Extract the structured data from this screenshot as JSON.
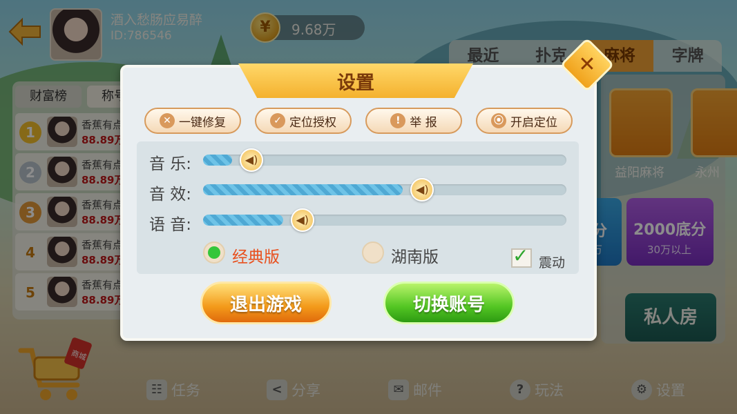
{
  "profile": {
    "nickname": "酒入愁肠应易醉",
    "id_text": "ID:786546",
    "coins": "9.68万"
  },
  "game_tabs": [
    "最近",
    "扑克",
    "麻将",
    "字牌"
  ],
  "active_game_tab": 2,
  "game_cards": [
    {
      "label": "益阳麻将"
    },
    {
      "label": "永州"
    }
  ],
  "level_cards": [
    {
      "title": "分",
      "sub": "万"
    },
    {
      "title": "2000底分",
      "sub": "30万以上"
    }
  ],
  "private_room_label": "私人房",
  "rank": {
    "tabs": [
      "财富榜",
      "称号榜"
    ],
    "rows": [
      {
        "badge": "1",
        "name": "香蕉有点",
        "score": "88.89万"
      },
      {
        "badge": "2",
        "name": "香蕉有点",
        "score": "88.89万"
      },
      {
        "badge": "3",
        "name": "香蕉有点",
        "score": "88.89万"
      },
      {
        "badge": "4",
        "name": "香蕉有点",
        "score": "88.89万"
      },
      {
        "badge": "5",
        "name": "香蕉有点",
        "score": "88.89万"
      }
    ]
  },
  "bottom_nav": [
    "任务",
    "分享",
    "邮件",
    "玩法",
    "设置"
  ],
  "shop_label": "商城",
  "settings": {
    "title": "设置",
    "actions": [
      "一键修复",
      "定位授权",
      "举 报",
      "开启定位"
    ],
    "sliders": [
      {
        "label": "音 乐:",
        "value": 0.08
      },
      {
        "label": "音 效:",
        "value": 0.55
      },
      {
        "label": "语 音:",
        "value": 0.22
      }
    ],
    "versions": [
      {
        "label": "经典版",
        "checked": true,
        "color": "#e8501e"
      },
      {
        "label": "湖南版",
        "checked": false,
        "color": "#444444"
      }
    ],
    "vibrate": {
      "label": "震动",
      "checked": true
    },
    "quit_label": "退出游戏",
    "switch_label": "切换账号"
  }
}
